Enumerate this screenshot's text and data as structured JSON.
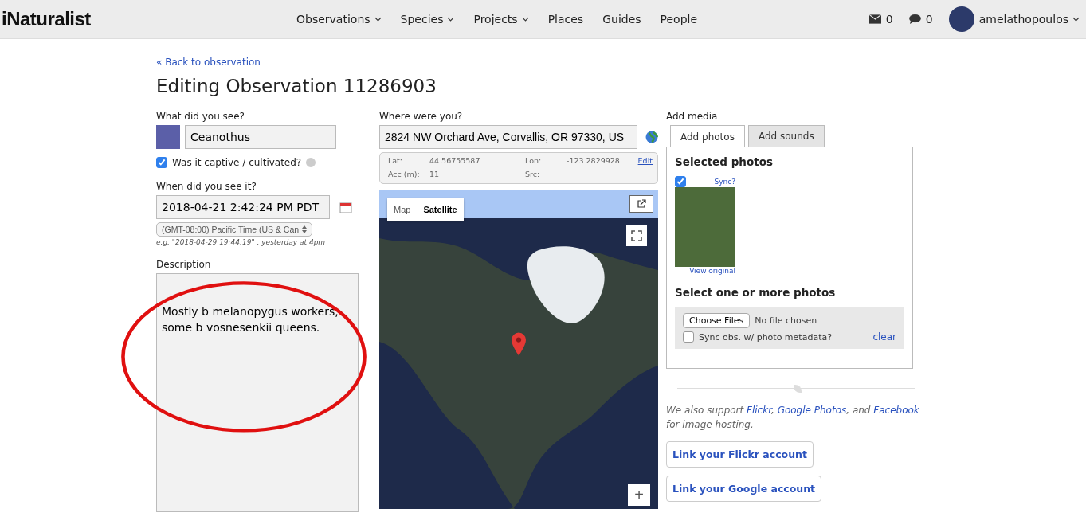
{
  "nav": {
    "logo": "iNaturalist",
    "menu": [
      {
        "label": "Observations",
        "dropdown": true
      },
      {
        "label": "Species",
        "dropdown": true
      },
      {
        "label": "Projects",
        "dropdown": true
      },
      {
        "label": "Places",
        "dropdown": false
      },
      {
        "label": "Guides",
        "dropdown": false
      },
      {
        "label": "People",
        "dropdown": false
      }
    ],
    "messages": "0",
    "comments": "0",
    "user": "amelathopoulos"
  },
  "back_link": "« Back to observation",
  "title": "Editing Observation 11286903",
  "what": {
    "label": "What did you see?",
    "value": "Ceanothus",
    "captive_label": "Was it captive / cultivated?",
    "captive": true
  },
  "when": {
    "label": "When did you see it?",
    "value": "2018-04-21 2:42:24 PM PDT",
    "timezone": "(GMT-08:00) Pacific Time (US & Can",
    "hint": "e.g. \"2018-04-29 19:44:19\" , yesterday at 4pm"
  },
  "description": {
    "label": "Description",
    "value": "Mostly b melanopygus workers, some b vosnesenkii queens."
  },
  "where": {
    "label": "Where were you?",
    "value": "2824 NW Orchard Ave, Corvallis, OR 97330, US",
    "lat_label": "Lat:",
    "lat": "44.56755587",
    "lon_label": "Lon:",
    "lon": "-123.2829928",
    "edit": "Edit",
    "acc_label": "Acc (m):",
    "acc": "11",
    "src_label": "Src:"
  },
  "map": {
    "types": [
      {
        "label": "Map",
        "selected": false
      },
      {
        "label": "Satellite",
        "selected": true
      }
    ],
    "zoom_in": "+"
  },
  "media": {
    "label": "Add media",
    "tabs": [
      {
        "label": "Add photos",
        "selected": true
      },
      {
        "label": "Add sounds",
        "selected": false
      }
    ],
    "selected_heading": "Selected photos",
    "photo": {
      "checked": true,
      "sync": "Sync?",
      "view": "View original"
    },
    "select_heading": "Select one or more photos",
    "choose": "Choose Files",
    "no_file": "No file chosen",
    "sync_meta": "Sync obs. w/ photo metadata?",
    "sync_meta_checked": false,
    "clear": "clear"
  },
  "support_note": [
    {
      "kind": "text",
      "text": "We also support "
    },
    {
      "kind": "link",
      "text": "Flickr"
    },
    {
      "kind": "text",
      "text": ", "
    },
    {
      "kind": "link",
      "text": "Google Photos"
    },
    {
      "kind": "text",
      "text": ", and "
    },
    {
      "kind": "link",
      "text": "Facebook"
    },
    {
      "kind": "text",
      "text": " for image hosting."
    }
  ],
  "link_buttons": [
    "Link your Flickr account",
    "Link your Google account"
  ]
}
